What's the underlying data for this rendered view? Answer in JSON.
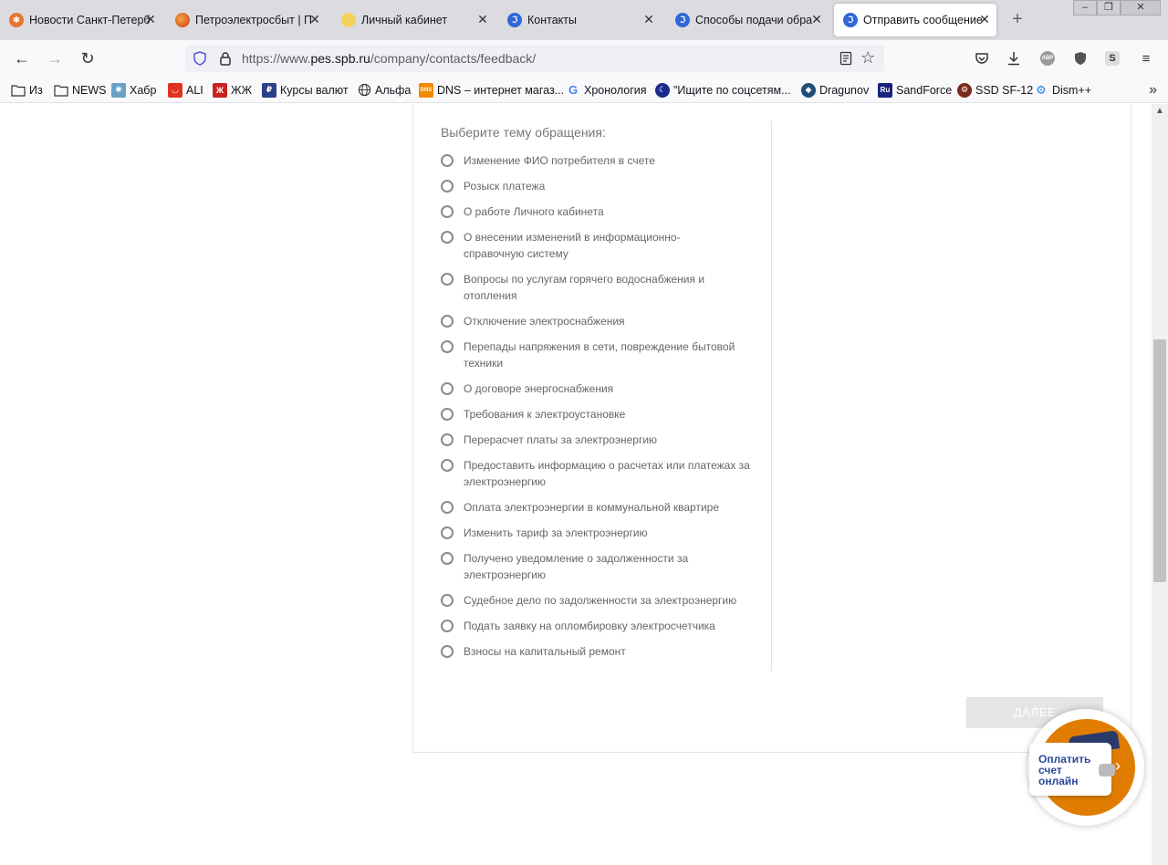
{
  "tabs": [
    {
      "label": "Новости Санкт-Петерб",
      "icon": "news-icon",
      "color": "#e8742a",
      "active": false
    },
    {
      "label": "Петроэлектросбыт | П",
      "icon": "pes-logo-icon",
      "color": "#d4452a",
      "active": false
    },
    {
      "label": "Личный кабинет",
      "icon": "lightbulb-icon",
      "color": "#f3d25b",
      "active": false
    },
    {
      "label": "Контакты",
      "icon": "pes-site-icon",
      "color": "#2f67d8",
      "active": false
    },
    {
      "label": "Способы подачи обра",
      "icon": "pes-site-icon",
      "color": "#2f67d8",
      "active": false
    },
    {
      "label": "Отправить сообщение",
      "icon": "pes-site-icon",
      "color": "#2f67d8",
      "active": true
    }
  ],
  "navbar": {
    "url_prefix": "https://www.",
    "url_host": "pes.spb.ru",
    "url_path": "/company/contacts/feedback/"
  },
  "bookmarks": [
    {
      "label": "Из",
      "icon": "folder-icon"
    },
    {
      "label": "NEWS",
      "icon": "folder-icon"
    },
    {
      "label": "Хабр",
      "icon": "habr-icon"
    },
    {
      "label": "ALI",
      "icon": "aliexpress-icon"
    },
    {
      "label": "ЖЖ",
      "icon": "livejournal-icon"
    },
    {
      "label": "Курсы валют",
      "icon": "currency-icon"
    },
    {
      "label": "Альфа",
      "icon": "globe-icon"
    },
    {
      "label": "DNS – интернет магаз...",
      "icon": "dns-icon"
    },
    {
      "label": "Хронология",
      "icon": "google-icon"
    },
    {
      "label": "\"Ищите по соцсетям...",
      "icon": "search-social-icon"
    },
    {
      "label": "Dragunov",
      "icon": "dragunov-icon"
    },
    {
      "label": "SandForce",
      "icon": "sandforce-icon"
    },
    {
      "label": "SSD SF-12",
      "icon": "ssd-icon"
    },
    {
      "label": "Dism++",
      "icon": "dism-icon"
    }
  ],
  "form": {
    "legend": "Выберите тему обращения:",
    "options": [
      "Изменение ФИО потребителя в счете",
      "Розыск платежа",
      "О работе Личного кабинета",
      "О внесении изменений в информационно-справочную систему",
      "Вопросы по услугам горячего водоснабжения и отопления",
      "Отключение электроснабжения",
      "Перепады напряжения в сети, повреждение бытовой техники",
      "О договоре энергоснабжения",
      "Требования к электроустановке",
      "Перерасчет платы за электроэнергию",
      "Предоставить информацию о расчетах или платежах за электроэнергию",
      "Оплата электроэнергии в коммунальной квартире",
      "Изменить тариф за электроэнергию",
      "Получено уведомление о задолженности за электроэнергию",
      "Судебное дело по задолженности за электроэнергию",
      "Подать заявку на опломбировку электросчетчика",
      "Взносы на капитальный ремонт"
    ],
    "next_label": "ДАЛЕЕ"
  },
  "pay_widget": {
    "text": "Оплатить\nсчет\nонлайн"
  }
}
